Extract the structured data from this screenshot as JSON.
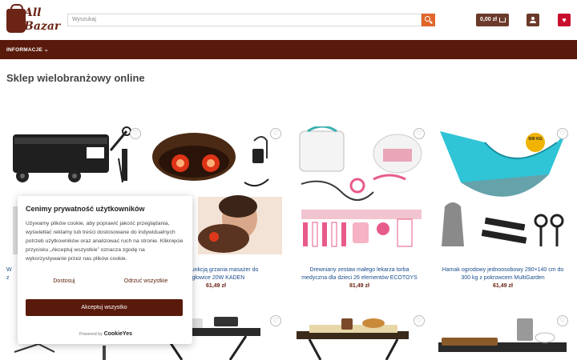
{
  "brand": {
    "line1": "All",
    "line2": "Bazar"
  },
  "search": {
    "placeholder": "Wyszukaj"
  },
  "header": {
    "cart_label": "0,00 zł"
  },
  "nav": {
    "items": [
      {
        "label": "INFORMACJE ⌄"
      }
    ]
  },
  "page": {
    "title": "Sklep wielobranżowy online"
  },
  "products": [
    {
      "name_line1": "W",
      "name_line2": "z",
      "price": ""
    },
    {
      "name_line1": "jąca z funkcją grzania masażer do",
      "name_line2": "4 głowice 20W KADEN",
      "price": "61,49 zł"
    },
    {
      "name_line1": "Drewniany zestaw małego lekarza torba",
      "name_line2": "medyczna dla dzieci 26 elementów ECOTOYS",
      "price": "81,49 zł"
    },
    {
      "name_line1": "Hamak ogrodowy jednoosobowy 290×140 cm do",
      "name_line2": "300 kg z pokrowcem MultiGarden",
      "price": "61,49 zł"
    }
  ],
  "badge": {
    "text": "500 KG"
  },
  "cookie": {
    "title": "Cenimy prywatność użytkowników",
    "text": "Używamy plików cookie, aby poprawić jakość przeglądania, wyświetlać reklamy lub treści dostosowane do indywidualnych potrzeb użytkowników oraz analizować ruch na stronie. Kliknięcie przycisku „Akceptuj wszystkie” oznacza zgodę na wykorzystywanie przez nas plików cookie.",
    "customize_label": "Dostosuj",
    "reject_label": "Odrzuć wszystkie",
    "accept_label": "Akceptuj wszystko",
    "powered_prefix": "Powered by",
    "powered_brand": "CookieYes"
  },
  "colors": {
    "brand": "#5a1a0b",
    "accent": "#e0662a",
    "wishlist": "#c8102e",
    "link": "#1a4d8c"
  }
}
